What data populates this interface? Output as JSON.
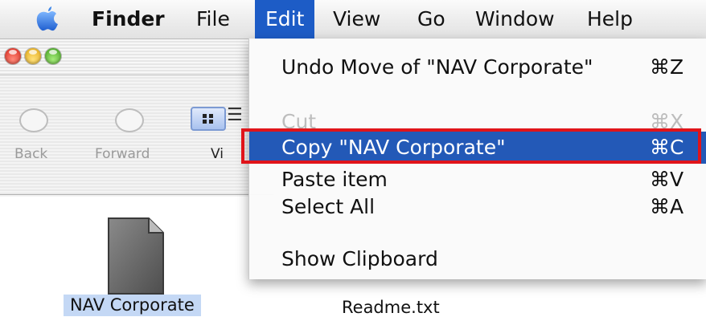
{
  "menubar": {
    "apple_icon": "apple-icon",
    "items": [
      "Finder",
      "File",
      "Edit",
      "View",
      "Go",
      "Window",
      "Help"
    ],
    "active_item": "Edit"
  },
  "window": {
    "toolbar": {
      "back_label": "Back",
      "forward_label": "Forward",
      "view_label": "Vi"
    },
    "files": [
      {
        "name": "NAV Corporate",
        "selected": true
      },
      {
        "name": "Readme.txt",
        "selected": false
      }
    ]
  },
  "edit_menu": {
    "items": [
      {
        "label": "Undo Move of \"NAV Corporate\"",
        "shortcut": "⌘Z",
        "enabled": true,
        "highlighted": false
      },
      {
        "label": "Cut",
        "shortcut": "⌘X",
        "enabled": false,
        "highlighted": false
      },
      {
        "label": "Copy \"NAV Corporate\"",
        "shortcut": "⌘C",
        "enabled": true,
        "highlighted": true
      },
      {
        "label": "Paste item",
        "shortcut": "⌘V",
        "enabled": true,
        "highlighted": false
      },
      {
        "label": "Select All",
        "shortcut": "⌘A",
        "enabled": true,
        "highlighted": false
      },
      {
        "label": "Show Clipboard",
        "shortcut": "",
        "enabled": true,
        "highlighted": false
      }
    ]
  },
  "colors": {
    "menu_highlight": "#2359b7",
    "annotation_box": "#e0141a",
    "selection": "#c4d8f5"
  }
}
